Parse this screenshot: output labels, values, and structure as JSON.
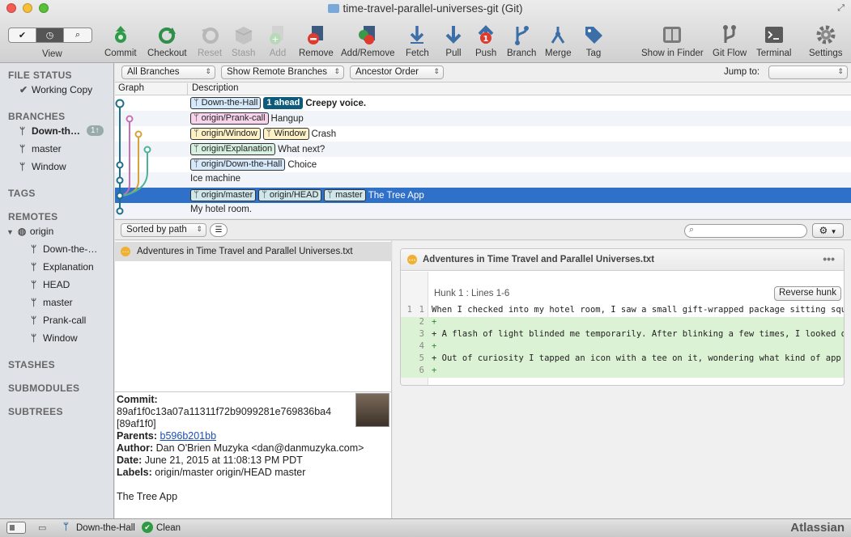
{
  "window": {
    "title": "time-travel-parallel-universes-git (Git)"
  },
  "toolbar": {
    "view_label": "View",
    "buttons": [
      {
        "label": "Commit"
      },
      {
        "label": "Checkout"
      },
      {
        "label": "Reset"
      },
      {
        "label": "Stash"
      },
      {
        "label": "Add"
      },
      {
        "label": "Remove"
      },
      {
        "label": "Add/Remove"
      },
      {
        "label": "Fetch"
      },
      {
        "label": "Pull"
      },
      {
        "label": "Push"
      },
      {
        "label": "Branch"
      },
      {
        "label": "Merge"
      },
      {
        "label": "Tag"
      },
      {
        "label": "Show in Finder"
      },
      {
        "label": "Git Flow"
      },
      {
        "label": "Terminal"
      },
      {
        "label": "Settings"
      }
    ],
    "push_count": "1"
  },
  "filters": {
    "branches": "All Branches",
    "remote": "Show Remote Branches",
    "order": "Ancestor Order",
    "jump_label": "Jump to:"
  },
  "sidebar": {
    "file_status": "FILE STATUS",
    "working_copy": "Working Copy",
    "branches_header": "BRANCHES",
    "branches": [
      {
        "label": "Down-th…",
        "badge": "1↑"
      },
      {
        "label": "master"
      },
      {
        "label": "Window"
      }
    ],
    "tags_header": "TAGS",
    "remotes_header": "REMOTES",
    "remote_name": "origin",
    "remote_branches": [
      "Down-the-…",
      "Explanation",
      "HEAD",
      "master",
      "Prank-call",
      "Window"
    ],
    "stashes": "STASHES",
    "submodules": "SUBMODULES",
    "subtrees": "SUBTREES"
  },
  "log": {
    "col_graph": "Graph",
    "col_desc": "Description",
    "rows": [
      {
        "tags": [
          "Down-the-Hall"
        ],
        "ahead": "1 ahead",
        "msg": "Creepy voice."
      },
      {
        "tags": [
          "origin/Prank-call"
        ],
        "msg": "Hangup"
      },
      {
        "tags": [
          "origin/Window",
          "Window"
        ],
        "msg": "Crash"
      },
      {
        "tags": [
          "origin/Explanation"
        ],
        "msg": "What next?"
      },
      {
        "tags": [
          "origin/Down-the-Hall"
        ],
        "msg": "Choice"
      },
      {
        "tags": [],
        "msg": "Ice machine"
      },
      {
        "tags": [
          "origin/master",
          "origin/HEAD",
          "master"
        ],
        "msg": "The Tree App"
      },
      {
        "tags": [],
        "msg": "My hotel room."
      }
    ]
  },
  "files": {
    "sort_label": "Sorted by path",
    "file": "Adventures in Time Travel and Parallel Universes.txt"
  },
  "commit": {
    "commit_label": "Commit:",
    "hash": "89af1f0c13a07a11311f72b9099281e769836ba4",
    "short": "[89af1f0]",
    "parents_label": "Parents:",
    "parent": "b596b201bb",
    "author_label": "Author:",
    "author": "Dan O'Brien Muzyka <dan@danmuzyka.com>",
    "date_label": "Date:",
    "date": "June 21, 2015 at 11:08:13 PM PDT",
    "labels_label": "Labels:",
    "labels": "origin/master origin/HEAD master",
    "message": "The Tree App"
  },
  "diff": {
    "file": "Adventures in Time Travel and Parallel Universes.txt",
    "hunk": "Hunk 1 : Lines 1-6",
    "reverse": "Reverse hunk",
    "lines": [
      {
        "old": "1",
        "new": "1",
        "text": " When I checked into my hotel room, I saw a small gift-wrapped package sitting squar",
        "add": false
      },
      {
        "old": "",
        "new": "2",
        "text": "+",
        "add": true
      },
      {
        "old": "",
        "new": "3",
        "text": "+ A flash of light blinded me temporarily. After blinking a few times, I looked down",
        "add": true
      },
      {
        "old": "",
        "new": "4",
        "text": "+",
        "add": true
      },
      {
        "old": "",
        "new": "5",
        "text": "+ Out of curiosity I tapped an icon with a tee on it, wondering what kind of app woul",
        "add": true
      },
      {
        "old": "",
        "new": "6",
        "text": "+",
        "add": true
      }
    ]
  },
  "status": {
    "branch": "Down-the-Hall",
    "state": "Clean",
    "brand": "Atlassian"
  }
}
